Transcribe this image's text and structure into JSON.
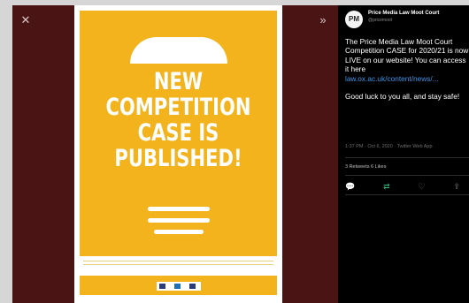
{
  "viewer": {
    "close_icon": "close-icon",
    "expand_icon": "chevron-right-icon"
  },
  "poster": {
    "headline_lines": [
      "NEW",
      "COMPETITION",
      "CASE IS",
      "PUBLISHED!"
    ],
    "colors": {
      "yellow": "#f2b31c",
      "white": "#ffffff"
    }
  },
  "tweet": {
    "author": "Price Media Law Moot Court",
    "handle": "@pricemoot",
    "avatar_text": "PM",
    "text_line1": "The Price Media Law Moot Court Competition CASE for 2020/21 is now LIVE on our website! You can access it here",
    "link": "law.ox.ac.uk/content/news/...",
    "text_line2": "Good luck to you all, and stay safe!",
    "meta": "1:37 PM · Oct 6, 2020 · Twitter Web App",
    "stats": "3 Retweets  6 Likes",
    "actions": [
      "reply-icon",
      "retweet-icon",
      "like-icon",
      "share-icon"
    ]
  }
}
